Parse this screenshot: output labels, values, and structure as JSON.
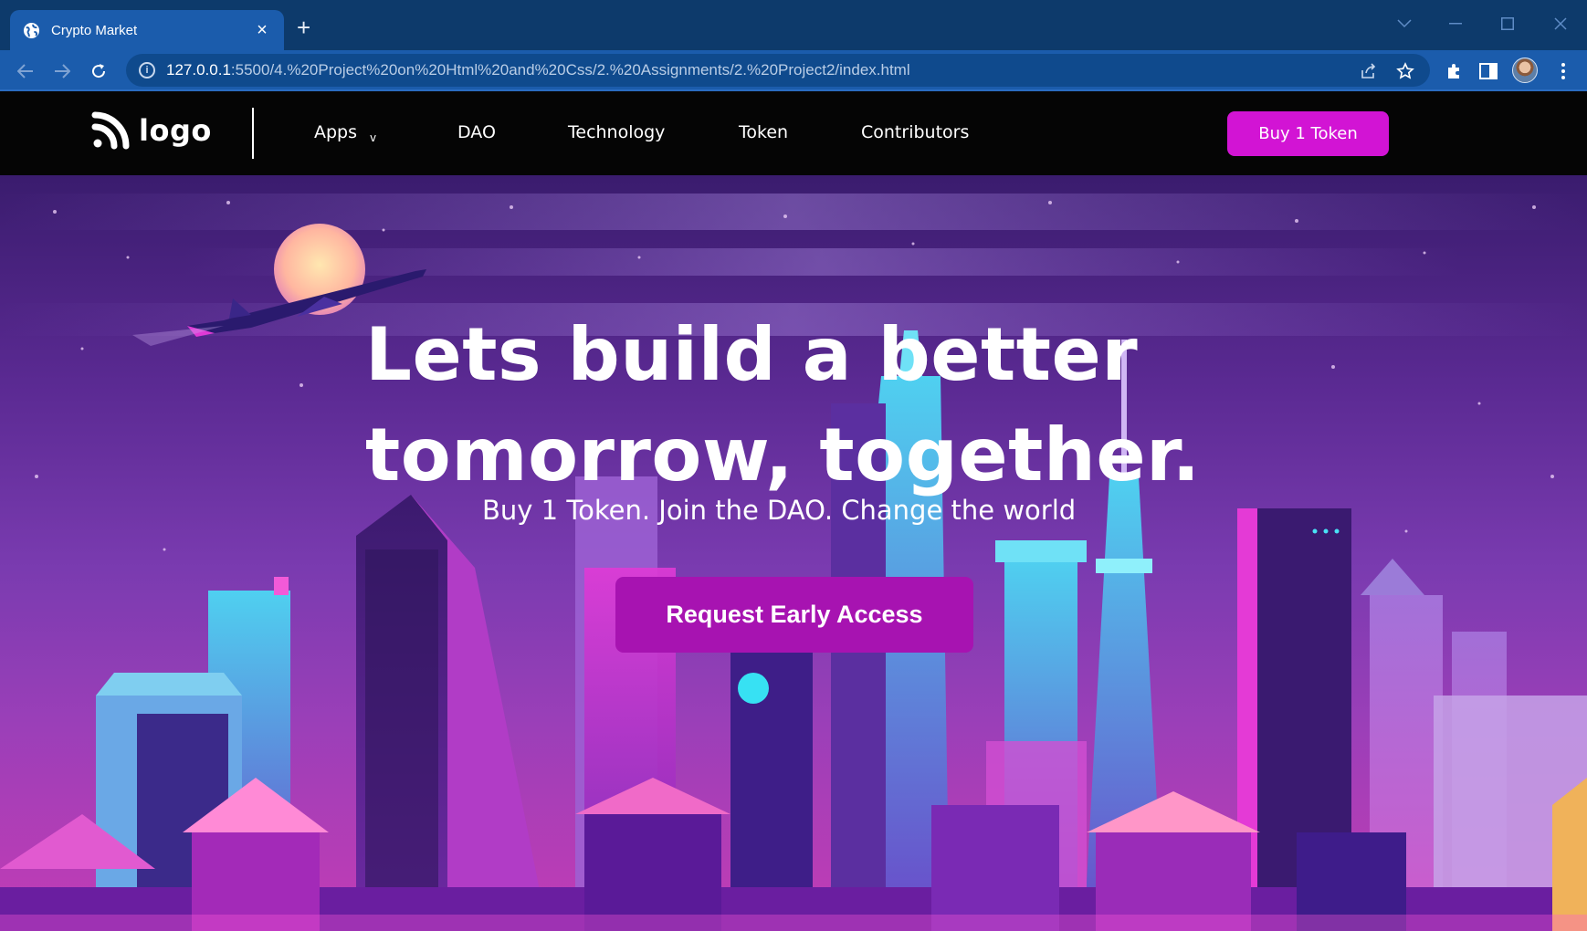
{
  "browser": {
    "tab_title": "Crypto Market",
    "url_host": "127.0.0.1",
    "url_rest": ":5500/4.%20Project%20on%20Html%20and%20Css/2.%20Assignments/2.%20Project2/index.html",
    "icons": [
      "globe-icon",
      "close-icon",
      "plus-icon",
      "chevron-down-icon",
      "minimize-icon",
      "maximize-icon",
      "close-window-icon",
      "back-icon",
      "forward-icon",
      "reload-icon",
      "info-icon",
      "share-icon",
      "star-icon",
      "extensions-icon",
      "sidebar-icon",
      "menu-icon"
    ]
  },
  "site": {
    "logo_text": "logo",
    "nav": {
      "apps": "Apps",
      "apps_caret": "v",
      "dao": "DAO",
      "technology": "Technology",
      "token": "Token",
      "contributors": "Contributors"
    },
    "buy_button": "Buy 1 Token"
  },
  "hero": {
    "headline_line1": "Lets build a better",
    "headline_line2": "tomorrow, together.",
    "subline": "Buy 1 Token. Join the DAO. Change the world",
    "cta": "Request Early Access"
  },
  "colors": {
    "accent": "#d214d4",
    "cta": "#a713b1",
    "navbar": "#050505",
    "chrome": "#1b5cac"
  }
}
